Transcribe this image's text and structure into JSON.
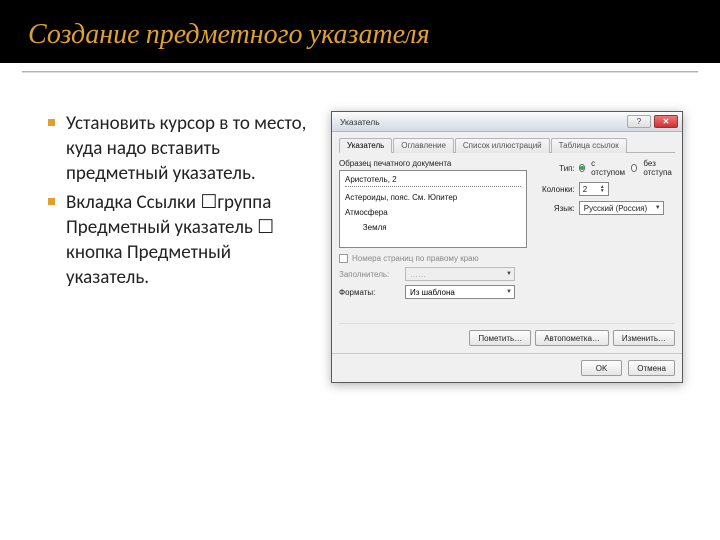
{
  "slide": {
    "title": "Создание предметного указателя",
    "bullets": [
      "Установить курсор в то место, куда надо вставить предметный указатель.",
      "Вкладка Ссылки ☐группа Предметный указатель  ☐ кнопка Предметный указатель."
    ]
  },
  "dialog": {
    "caption": "Указатель",
    "tabs": [
      "Указатель",
      "Оглавление",
      "Список иллюстраций",
      "Таблица ссылок"
    ],
    "preview_label": "Образец печатного документа",
    "preview_lines": {
      "l1": "Аристотель, 2",
      "l2": "Астероиды, пояс. См. Юпитер",
      "l3": "Атмосфера",
      "l4": "        Земля"
    },
    "type": {
      "label": "Тип:",
      "opt1": "с отступом",
      "opt2": "без отступа"
    },
    "columns": {
      "label": "Колонки:",
      "value": "2"
    },
    "lang": {
      "label": "Язык:",
      "value": "Русский (Россия)"
    },
    "chk_pages": "Номера страниц по правому краю",
    "filler": {
      "label": "Заполнитель:",
      "value": "……"
    },
    "formats": {
      "label": "Форматы:",
      "value": "Из шаблона"
    },
    "buttons": {
      "mark": "Пометить…",
      "automark": "Автопометка…",
      "modify": "Изменить…",
      "ok": "OK",
      "cancel": "Отмена"
    }
  }
}
